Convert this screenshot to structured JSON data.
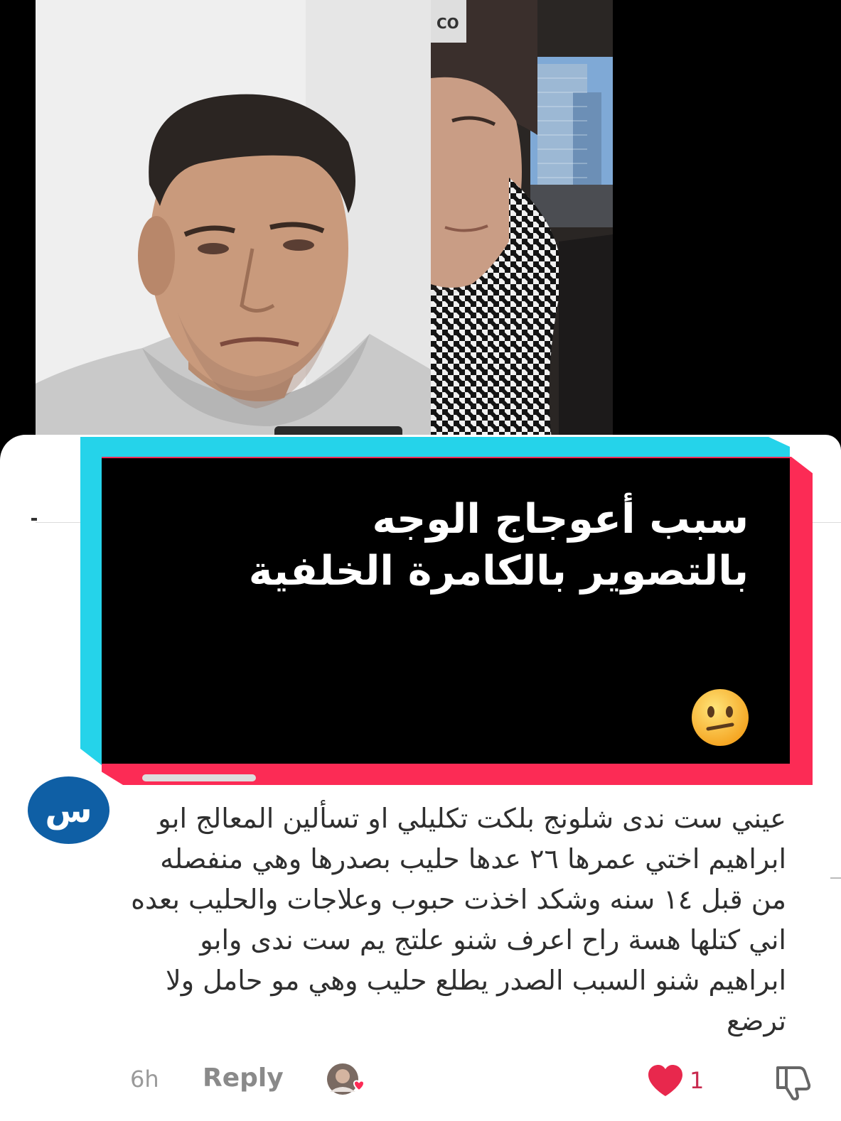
{
  "overlay": {
    "title_line1": "سبب أعوجاج الوجه",
    "title_line2": "بالتصوير بالكامرة الخلفية",
    "emoji": "neutral-face-emoji"
  },
  "comment": {
    "avatar_letter": "س",
    "avatar_color": "#0f5fa5",
    "text": "عيني ست ندى شلونج بلكت تكليلي او تسألين المعالج ابو ابراهيم اختي عمرها ٢٦ عدها حليب بصدرها وهي منفصله من قبل ١٤ سنه وشكد اخذت حبوب وعلاجات والحليب بعده اني كتلها هسة راح اعرف شنو علتج يم ست ندى وابو ابراهيم شنو السبب الصدر يطلع حليب وهي مو حامل ولا ترضع",
    "time": "6h",
    "reply_label": "Reply",
    "like_count": "1",
    "liked": true
  },
  "colors": {
    "tiktok_cyan": "#25d3ea",
    "tiktok_pink": "#fc2b55",
    "like_red": "#e8284d"
  }
}
